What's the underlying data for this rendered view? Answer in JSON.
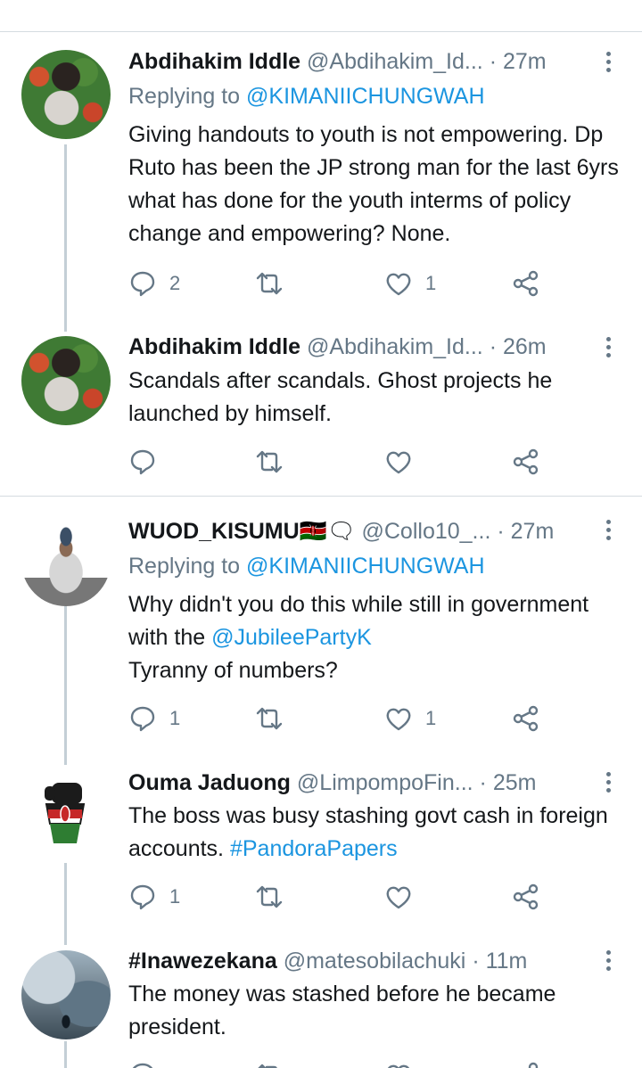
{
  "tweets": [
    {
      "name": "Abdihakim Iddle",
      "handle": "@Abdihakim_Id...",
      "time": "· 27m",
      "replying_label": "Replying to",
      "replying_to": "@KIMANIICHUNGWAH",
      "body": "Giving handouts to youth is not empowering. Dp Ruto has been the JP strong man for the last 6yrs what has done for the youth interms of policy change and empowering? None.",
      "replies": "2",
      "retweets": "",
      "likes": "1"
    },
    {
      "name": "Abdihakim Iddle",
      "handle": "@Abdihakim_Id...",
      "time": "· 26m",
      "body": "Scandals after scandals. Ghost projects he launched by himself.",
      "replies": "",
      "retweets": "",
      "likes": ""
    },
    {
      "name": "WUOD_KISUMU",
      "name_emoji": "🇰🇪🗨",
      "handle": "@Collo10_...",
      "time": "· 27m",
      "replying_label": "Replying to",
      "replying_to": "@KIMANIICHUNGWAH",
      "body_part1": "Why didn't you do this while still in government with the",
      "body_mention": "@JubileePartyK",
      "body_part2": "Tyranny of numbers?",
      "replies": "1",
      "retweets": "",
      "likes": "1"
    },
    {
      "name": "Ouma Jaduong",
      "handle": "@LimpompoFin...",
      "time": "· 25m",
      "body_part1": "The boss was busy stashing govt cash in foreign accounts.",
      "body_hashtag": "#PandoraPapers",
      "replies": "1",
      "retweets": "",
      "likes": ""
    },
    {
      "name": "#Inawezekana",
      "handle": "@matesobilachuki",
      "time": "· 11m",
      "body": "The money was stashed before he became president.",
      "replies": "",
      "retweets": "",
      "likes": ""
    }
  ],
  "colors": {
    "link": "#1b95e0",
    "secondary_text": "#657786",
    "thread_line": "#c4cfd6",
    "divider": "#d5dbe0"
  },
  "icons": [
    "reply-icon",
    "retweet-icon",
    "like-icon",
    "share-icon",
    "more-options-icon"
  ]
}
